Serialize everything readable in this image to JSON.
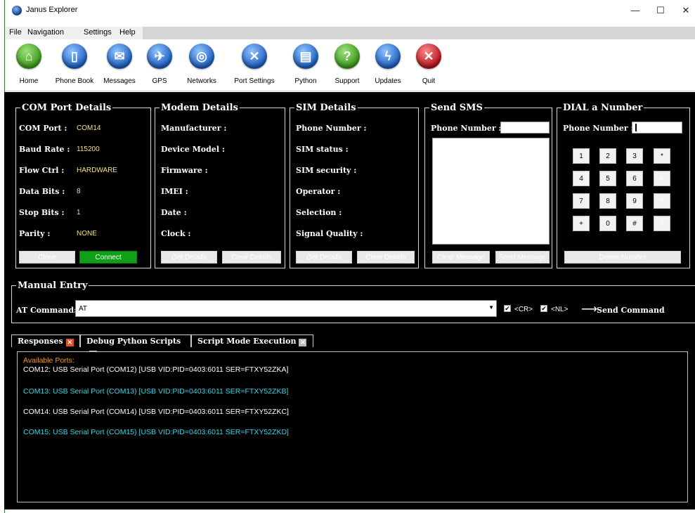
{
  "window": {
    "title": "Janus Explorer",
    "min": "—",
    "max": "☐",
    "close": "✕"
  },
  "menu": [
    "File",
    "Navigation",
    "Settings",
    "Help"
  ],
  "toolbar": [
    {
      "label": "Home",
      "icon": "home-icon",
      "color": "#4caf2a"
    },
    {
      "label": "Phone Book",
      "icon": "phone-icon",
      "color": "#2a6fd6"
    },
    {
      "label": "Messages",
      "icon": "envelope-icon",
      "color": "#2a6fd6"
    },
    {
      "label": "GPS",
      "icon": "satellite-icon",
      "color": "#2a6fd6"
    },
    {
      "label": "Networks",
      "icon": "globe-icon",
      "color": "#2a6fd6"
    },
    {
      "label": "Port Settings",
      "icon": "tools-icon",
      "color": "#2a6fd6"
    },
    {
      "label": "Python",
      "icon": "document-icon",
      "color": "#2a6fd6"
    },
    {
      "label": "Support",
      "icon": "help-icon",
      "color": "#4caf2a"
    },
    {
      "label": "Updates",
      "icon": "lightning-icon",
      "color": "#2a6fd6"
    },
    {
      "label": "Quit",
      "icon": "close-icon",
      "color": "#c8232c"
    }
  ],
  "com": {
    "title": "COM Port Details",
    "rows": [
      {
        "label": "COM Port :",
        "value": "COM14"
      },
      {
        "label": "Baud Rate :",
        "value": "115200"
      },
      {
        "label": "Flow Ctrl :",
        "value": "HARDWARE"
      },
      {
        "label": "Data Bits :",
        "value": "8"
      },
      {
        "label": "Stop Bits :",
        "value": "1"
      },
      {
        "label": "Parity :",
        "value": "NONE"
      }
    ],
    "close_label": "Close",
    "connect_label": "Connect"
  },
  "modem": {
    "title": "Modem Details",
    "rows": [
      "Manufacturer :",
      "Device Model :",
      "Firmware :",
      "IMEI :",
      "Date :",
      "Clock :"
    ],
    "get_label": "Get Details",
    "clear_label": "Clear Details"
  },
  "sim": {
    "title": "SIM Details",
    "rows": [
      "Phone Number :",
      "SIM status :",
      "SIM security :",
      "Operator :",
      "Selection :",
      "Signal Quality :"
    ],
    "get_label": "Get Details",
    "clear_label": "Clear Details"
  },
  "sms": {
    "title": "Send SMS",
    "phone_label": "Phone Number :",
    "clear_label": "Clear Message",
    "send_label": "Send Message"
  },
  "dial": {
    "title": "DIAL a Number",
    "phone_label": "Phone Number :",
    "keys": [
      [
        "1",
        "2",
        "3",
        "*"
      ],
      [
        "4",
        "5",
        "6",
        "R"
      ],
      [
        "7",
        "8",
        "9",
        "S"
      ],
      [
        "+",
        "0",
        "#",
        "0"
      ]
    ],
    "delete_label": "Delete Number"
  },
  "manual": {
    "title": "Manual Entry",
    "at_label": "AT Command:",
    "at_value": "AT",
    "cr_label": "<CR>",
    "nl_label": "<NL>",
    "send_label": "Send Command",
    "arrow": "⟶"
  },
  "tabs": [
    "Responses",
    "Debug Python Scripts",
    "Script Mode Execution"
  ],
  "console": {
    "header": "Available Ports:",
    "lines": [
      {
        "text": "COM12: USB Serial Port (COM12) [USB VID:PID=0403:6011 SER=FTXY52ZKA]",
        "color": "#ffffff"
      },
      {
        "text": "COM13: USB Serial Port (COM13) [USB VID:PID=0403:6011 SER=FTXY52ZKB]",
        "color": "#33d6e6"
      },
      {
        "text": "COM14: USB Serial Port (COM14) [USB VID:PID=0403:6011 SER=FTXY52ZKC]",
        "color": "#ffffff"
      },
      {
        "text": "COM15: USB Serial Port (COM15) [USB VID:PID=0403:6011 SER=FTXY52ZKD]",
        "color": "#33d6e6"
      }
    ],
    "header_color": "#f0a020"
  }
}
